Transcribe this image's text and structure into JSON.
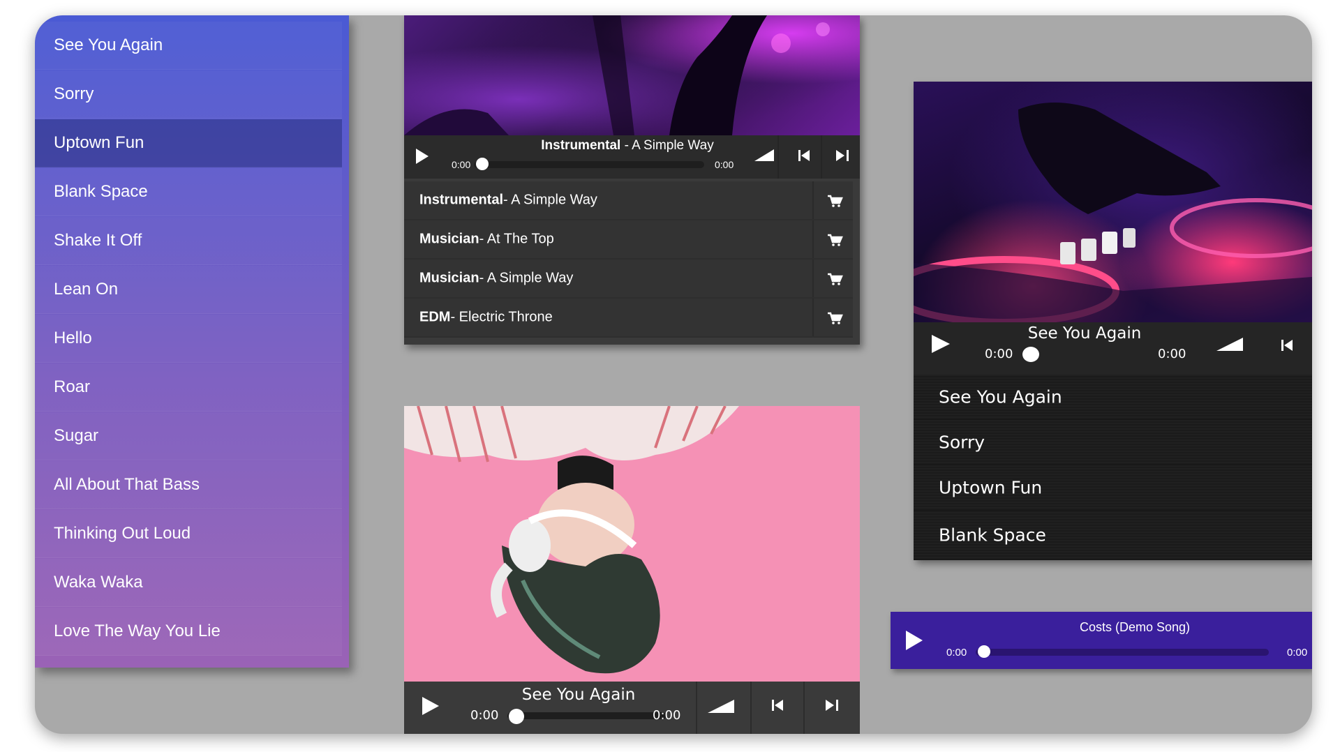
{
  "playlist": {
    "items": [
      {
        "label": "See You Again"
      },
      {
        "label": "Sorry"
      },
      {
        "label": "Uptown Fun"
      },
      {
        "label": "Blank Space"
      },
      {
        "label": "Shake It Off"
      },
      {
        "label": "Lean On"
      },
      {
        "label": "Hello"
      },
      {
        "label": "Roar"
      },
      {
        "label": "Sugar"
      },
      {
        "label": "All About That Bass"
      },
      {
        "label": "Thinking Out Loud"
      },
      {
        "label": "Waka Waka"
      },
      {
        "label": "Love The Way You Lie"
      }
    ],
    "active_index": 2
  },
  "player_top": {
    "now_playing_artist": "Instrumental",
    "now_playing_title": " - A Simple Way",
    "time_current": "0:00",
    "time_total": "0:00",
    "progress": 0,
    "tracks": [
      {
        "artist": "Instrumental",
        "title": "- A Simple Way"
      },
      {
        "artist": "Musician",
        "title": "- At The Top"
      },
      {
        "artist": "Musician",
        "title": "- A Simple Way"
      },
      {
        "artist": "EDM",
        "title": "- Electric Throne"
      }
    ]
  },
  "player_bottom": {
    "title": "See You Again",
    "time_current": "0:00",
    "time_total": "0:00",
    "progress": 0
  },
  "player_right": {
    "title": "See You Again",
    "time_current": "0:00",
    "time_total": "0:00",
    "progress": 0,
    "tracks": [
      {
        "label": "See You Again"
      },
      {
        "label": "Sorry"
      },
      {
        "label": "Uptown Fun"
      },
      {
        "label": "Blank Space"
      }
    ]
  },
  "player_mini": {
    "title": "Costs (Demo Song)",
    "time_current": "0:00",
    "time_total": "0:00",
    "progress": 0
  },
  "icons": {
    "play": "play-icon",
    "volume": "volume-icon",
    "previous": "skip-previous-icon",
    "next": "skip-next-icon",
    "cart": "cart-icon"
  },
  "colors": {
    "playlist_top": "#4a5ad4",
    "playlist_bottom": "#9a62b6",
    "mini_player_bg": "#3a1f9c",
    "background": "#a9a9a9"
  }
}
